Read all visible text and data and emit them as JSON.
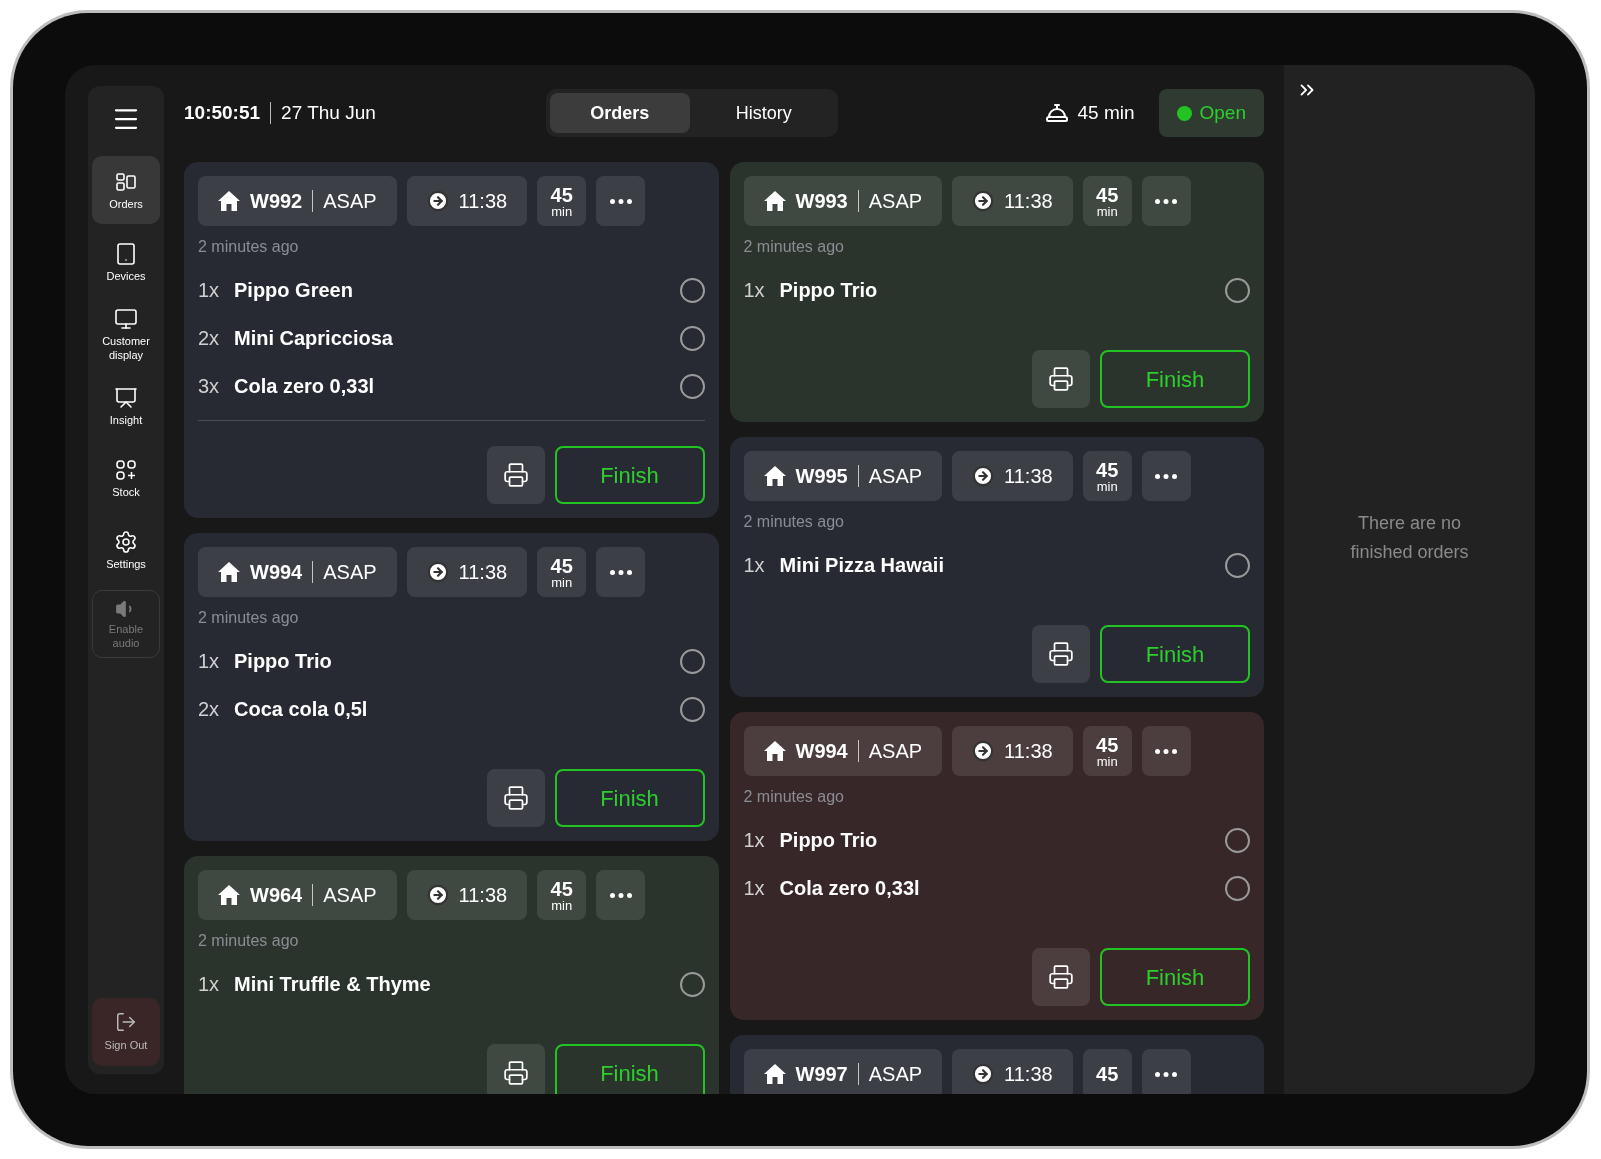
{
  "clock": {
    "time": "10:50:51",
    "date": "27 Thu Jun"
  },
  "tabs": [
    {
      "label": "Orders",
      "selected": true
    },
    {
      "label": "History",
      "selected": false
    }
  ],
  "prep_time": "45 min",
  "status": {
    "label": "Open",
    "on": true
  },
  "sidebar": {
    "items": [
      {
        "label": "Orders",
        "selected": true,
        "kind": "orders"
      },
      {
        "label": "Devices",
        "selected": false,
        "kind": "devices"
      },
      {
        "label": "Customer display",
        "selected": false,
        "kind": "display"
      },
      {
        "label": "Insight",
        "selected": false,
        "kind": "insight"
      },
      {
        "label": "Stock",
        "selected": false,
        "kind": "stock"
      },
      {
        "label": "Settings",
        "selected": false,
        "kind": "settings"
      }
    ],
    "audio": {
      "label": "Enable audio",
      "disabled": true
    },
    "sign_out": "Sign Out"
  },
  "columns": [
    [
      {
        "id": "W992",
        "tag": "ASAP",
        "time": "11:38",
        "eta": "45",
        "eta_unit": "min",
        "color": "#272a33",
        "ago": "2 minutes ago",
        "separator": true,
        "items": [
          {
            "qty": "1x",
            "name": "Pippo Green",
            "checked": false
          },
          {
            "qty": "2x",
            "name": "Mini Capricciosa",
            "checked": false
          },
          {
            "qty": "3x",
            "name": "Cola zero 0,33l",
            "checked": false
          }
        ],
        "finish": "Finish"
      },
      {
        "id": "W994",
        "tag": "ASAP",
        "time": "11:38",
        "eta": "45",
        "eta_unit": "min",
        "color": "#272a33",
        "ago": "2 minutes ago",
        "separator": false,
        "items": [
          {
            "qty": "1x",
            "name": "Pippo Trio",
            "checked": false
          },
          {
            "qty": "2x",
            "name": "Coca cola 0,5l",
            "checked": false
          }
        ],
        "finish": "Finish"
      },
      {
        "id": "W964",
        "tag": "ASAP",
        "time": "11:38",
        "eta": "45",
        "eta_unit": "min",
        "color": "#2a342c",
        "ago": "2 minutes ago",
        "separator": false,
        "items": [
          {
            "qty": "1x",
            "name": "Mini Truffle & Thyme",
            "checked": false
          }
        ],
        "finish": "Finish"
      }
    ],
    [
      {
        "id": "W993",
        "tag": "ASAP",
        "time": "11:38",
        "eta": "45",
        "eta_unit": "min",
        "color": "#2a342c",
        "ago": "2 minutes ago",
        "separator": false,
        "items": [
          {
            "qty": "1x",
            "name": "Pippo Trio",
            "checked": false
          }
        ],
        "finish": "Finish"
      },
      {
        "id": "W995",
        "tag": "ASAP",
        "time": "11:38",
        "eta": "45",
        "eta_unit": "min",
        "color": "#272a33",
        "ago": "2 minutes ago",
        "separator": false,
        "items": [
          {
            "qty": "1x",
            "name": "Mini Pizza Hawaii",
            "checked": false
          }
        ],
        "finish": "Finish"
      },
      {
        "id": "W994",
        "tag": "ASAP",
        "time": "11:38",
        "eta": "45",
        "eta_unit": "min",
        "color": "#382728",
        "ago": "2 minutes ago",
        "separator": false,
        "items": [
          {
            "qty": "1x",
            "name": "Pippo Trio",
            "checked": false
          },
          {
            "qty": "1x",
            "name": "Cola zero 0,33l",
            "checked": false
          }
        ],
        "finish": "Finish"
      },
      {
        "id": "W997",
        "tag": "ASAP",
        "time": "11:38",
        "eta": "45",
        "color": "#272a33"
      }
    ]
  ],
  "finished_panel": {
    "empty_text": "There are no finished orders"
  }
}
